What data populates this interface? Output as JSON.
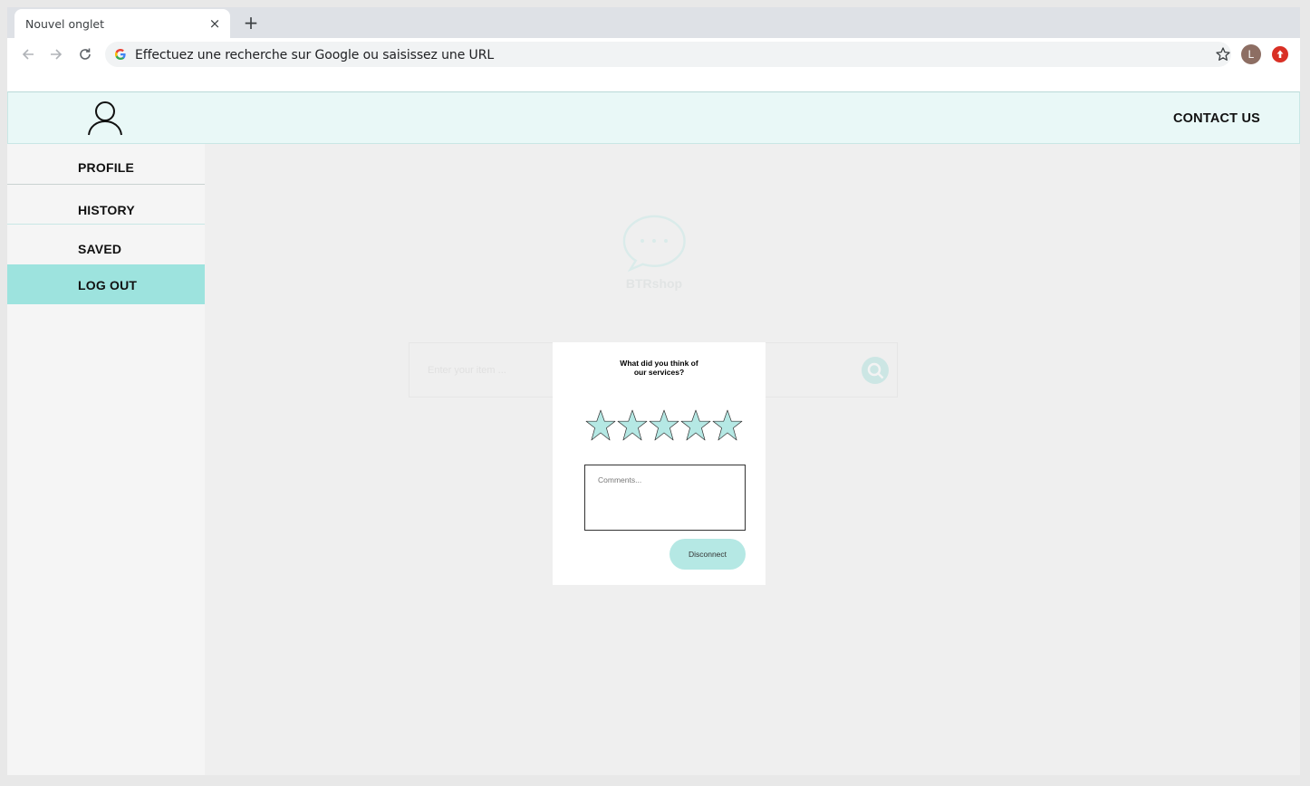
{
  "browser": {
    "tab_title": "Nouvel onglet",
    "tab_close": "×",
    "new_tab": "+",
    "omnibox_text": "Effectuez une recherche sur Google ou saisissez une URL",
    "profile_initial": "L"
  },
  "header": {
    "contact_label": "CONTACT US"
  },
  "sidebar": {
    "items": [
      {
        "label": "PROFILE"
      },
      {
        "label": "HISTORY"
      },
      {
        "label": "SAVED"
      },
      {
        "label": "LOG OUT"
      }
    ]
  },
  "background": {
    "brand_name": "BTRshop",
    "search_placeholder": "Enter your item ..."
  },
  "modal": {
    "question_line1": "What did you think of",
    "question_line2": "our  services?",
    "rating_max": 5,
    "rating_value": 0,
    "star_fill": "#b5e8e4",
    "comments_placeholder": "Comments...",
    "button_label": "Disconnect"
  },
  "colors": {
    "accent": "#9de3de",
    "header_bg": "#e9f8f7",
    "update_badge": "#d93025"
  }
}
